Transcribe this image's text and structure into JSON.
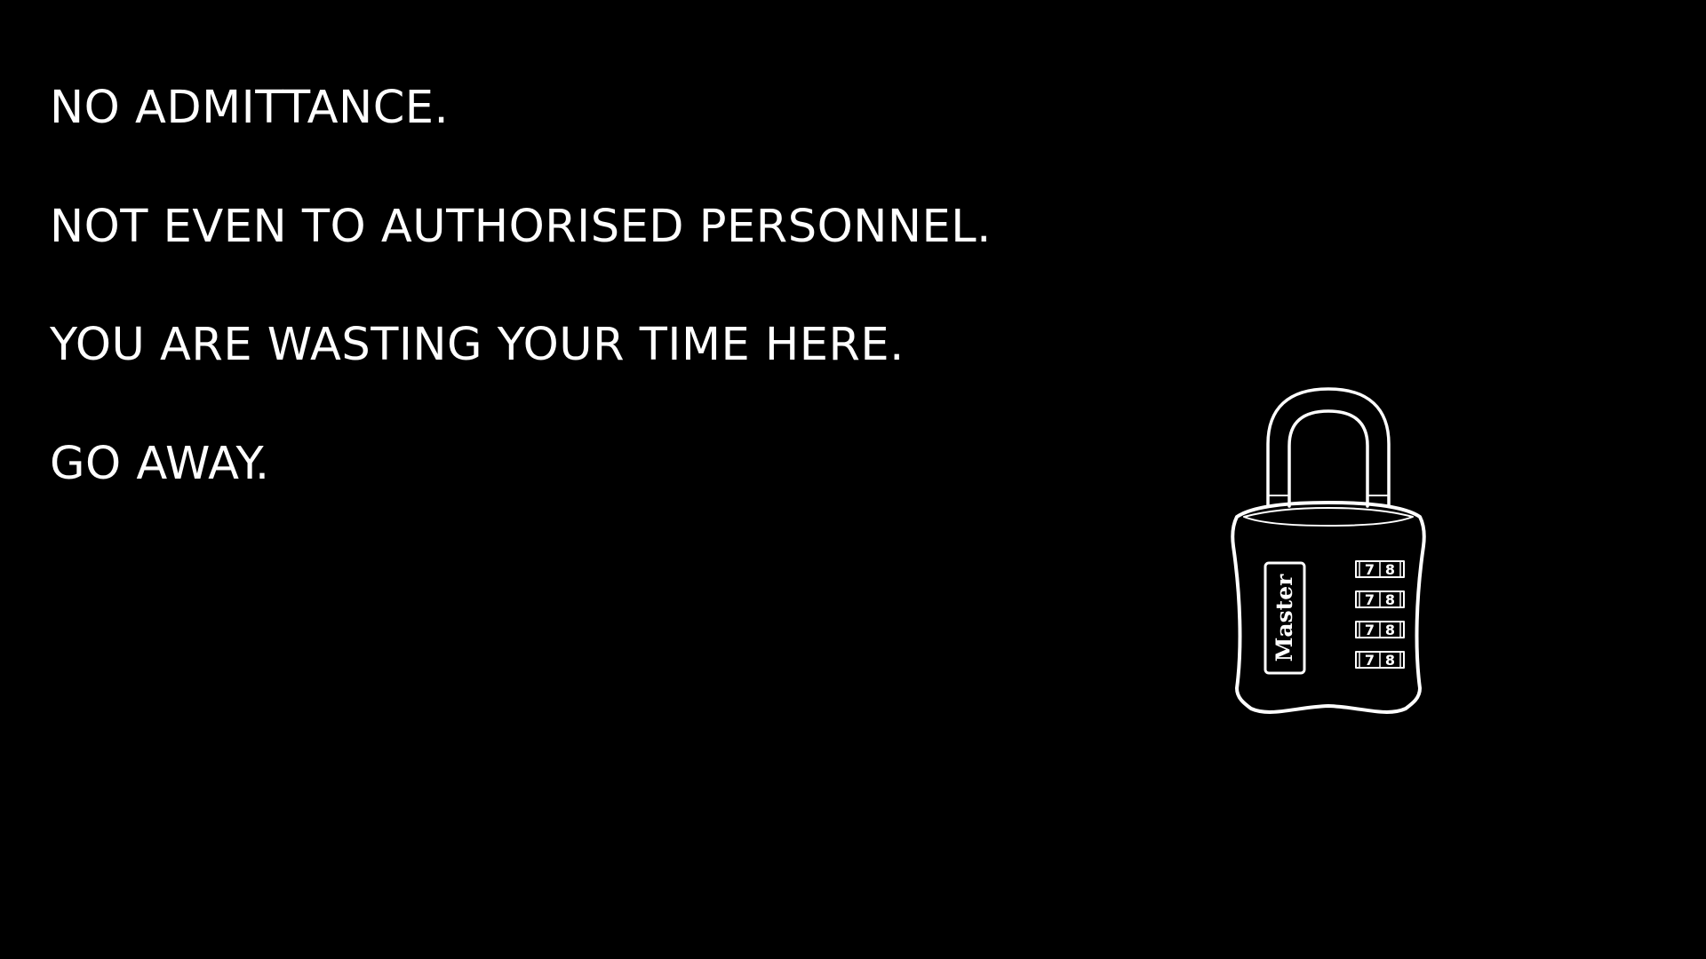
{
  "messages": [
    "NO ADMITTANCE.",
    "NOT EVEN TO AUTHORISED PERSONNEL.",
    "YOU ARE WASTING YOUR TIME HERE.",
    "GO AWAY."
  ],
  "padlock": {
    "brand": "Master",
    "dials": [
      {
        "left": "7",
        "right": "8"
      },
      {
        "left": "7",
        "right": "8"
      },
      {
        "left": "7",
        "right": "8"
      },
      {
        "left": "7",
        "right": "8"
      }
    ],
    "icon": "combination-padlock-icon"
  },
  "colors": {
    "background": "#000000",
    "foreground": "#ffffff"
  }
}
